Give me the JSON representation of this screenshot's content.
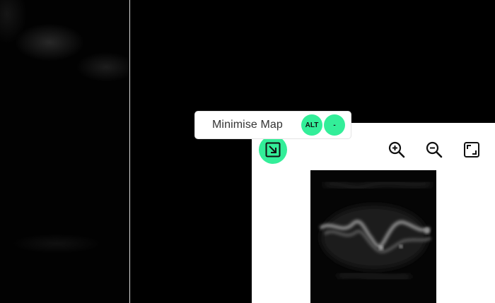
{
  "tooltip": {
    "label": "Minimise Map",
    "shortcut_keys": [
      "ALT",
      "-"
    ]
  },
  "minimap": {
    "collapse_icon": "arrow-down-right-box-icon",
    "tools": [
      {
        "name": "zoom-in",
        "icon": "zoom-in-icon"
      },
      {
        "name": "zoom-out",
        "icon": "zoom-out-icon"
      },
      {
        "name": "fit-to-screen",
        "icon": "fit-screen-icon"
      }
    ]
  },
  "colors": {
    "accent": "#33ee99",
    "background": "#000000",
    "panel": "#ffffff",
    "divider": "#d9d9d9"
  }
}
